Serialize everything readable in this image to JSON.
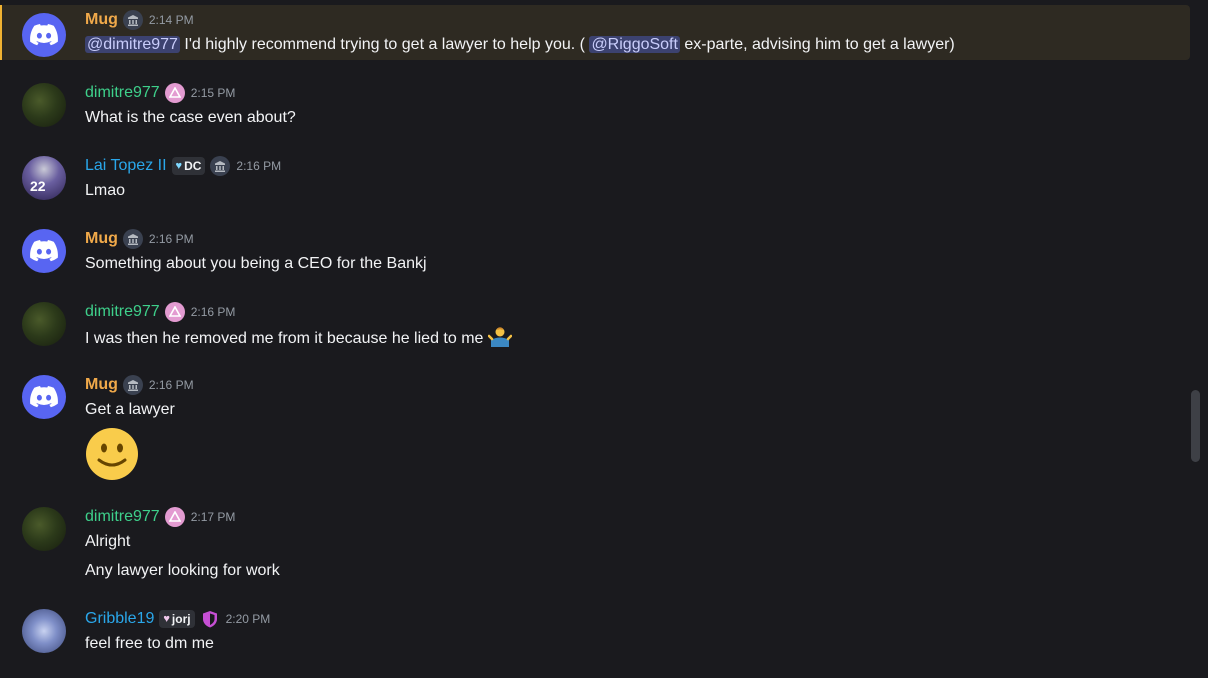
{
  "messages": [
    {
      "author": "Mug",
      "time": "2:14 PM",
      "mention1": "@dimitre977",
      "text1": " I'd highly recommend trying to get a lawyer to help you. ( ",
      "mention2": "@RiggoSoft",
      "text2": "  ex-parte, advising him to get a lawyer)"
    },
    {
      "author": "dimitre977",
      "time": "2:15 PM",
      "text": "What is the case even about?"
    },
    {
      "author": "Lai Topez II",
      "tag": "DC",
      "time": "2:16 PM",
      "text": "Lmao"
    },
    {
      "author": "Mug",
      "time": "2:16 PM",
      "text": "Something about you being a CEO for the Bankj"
    },
    {
      "author": "dimitre977",
      "time": "2:16 PM",
      "text": "I was then he removed me from it because he lied to me"
    },
    {
      "author": "Mug",
      "time": "2:16 PM",
      "text": "Get a lawyer"
    },
    {
      "author": "dimitre977",
      "time": "2:17 PM",
      "text": "Alright",
      "text2": "Any lawyer looking for work"
    },
    {
      "author": "Gribble19",
      "tag": "jorj",
      "time": "2:20 PM",
      "text": "feel free to dm me"
    }
  ],
  "avatars": {
    "lai_number": "22"
  },
  "colors": {
    "mug": "#f0a94a",
    "dimitre": "#3ed08b",
    "lai": "#2aa7ea",
    "gribble": "#2aa7ea",
    "highlight_border": "#f0b232",
    "background": "#1a1a1e"
  },
  "icons": {
    "discord_avatar": "discord-logo-icon",
    "gov_badge": "government-building-icon",
    "pink_badge": "triangle-badge-icon",
    "shield_badge": "shield-icon",
    "shrug_emoji": "person-shrugging-emoji",
    "smile_emoji": "slightly-smiling-face-emoji"
  }
}
